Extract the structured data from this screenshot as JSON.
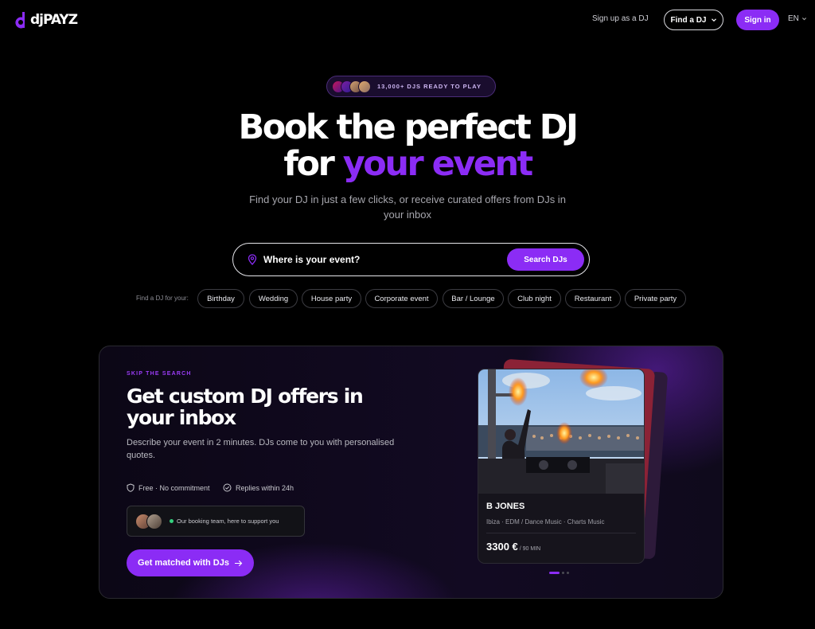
{
  "brand": {
    "logo_text": "djPAYZ"
  },
  "nav": {
    "signup_label": "Sign up as a DJ",
    "find_label": "Find a DJ",
    "signin_label": "Sign in",
    "lang_label": "EN"
  },
  "hero": {
    "badge_text": "13,000+ DJS READY TO PLAY",
    "title_line1": "Book the perfect DJ",
    "title_line2_plain": "for",
    "title_line2_accent": "your event",
    "subtitle": "Find your DJ in just a few clicks, or receive curated offers from DJs in your inbox"
  },
  "search": {
    "placeholder": "Where is your event?",
    "button_label": "Search DJs"
  },
  "categories": {
    "label": "Find a DJ for your:",
    "items": [
      "Birthday",
      "Wedding",
      "House party",
      "Corporate event",
      "Bar / Lounge",
      "Club night",
      "Restaurant",
      "Private party"
    ]
  },
  "offers": {
    "eyebrow": "SKIP THE SEARCH",
    "title": "Get custom DJ offers in your inbox",
    "description": "Describe your event in 2 minutes. DJs come to you with personalised quotes.",
    "feature1": "Free · No commitment",
    "feature2": "Replies within 24h",
    "support_text": "Our booking team, here to support you",
    "cta_label": "Get matched with DJs"
  },
  "dj_card": {
    "name": "B JONES",
    "genres": "Ibiza · EDM / Dance Music · Charts Music",
    "price": "3300 €",
    "price_unit": "/ 90 MIN"
  },
  "colors": {
    "accent": "#8b2cf5",
    "background": "#000000"
  }
}
